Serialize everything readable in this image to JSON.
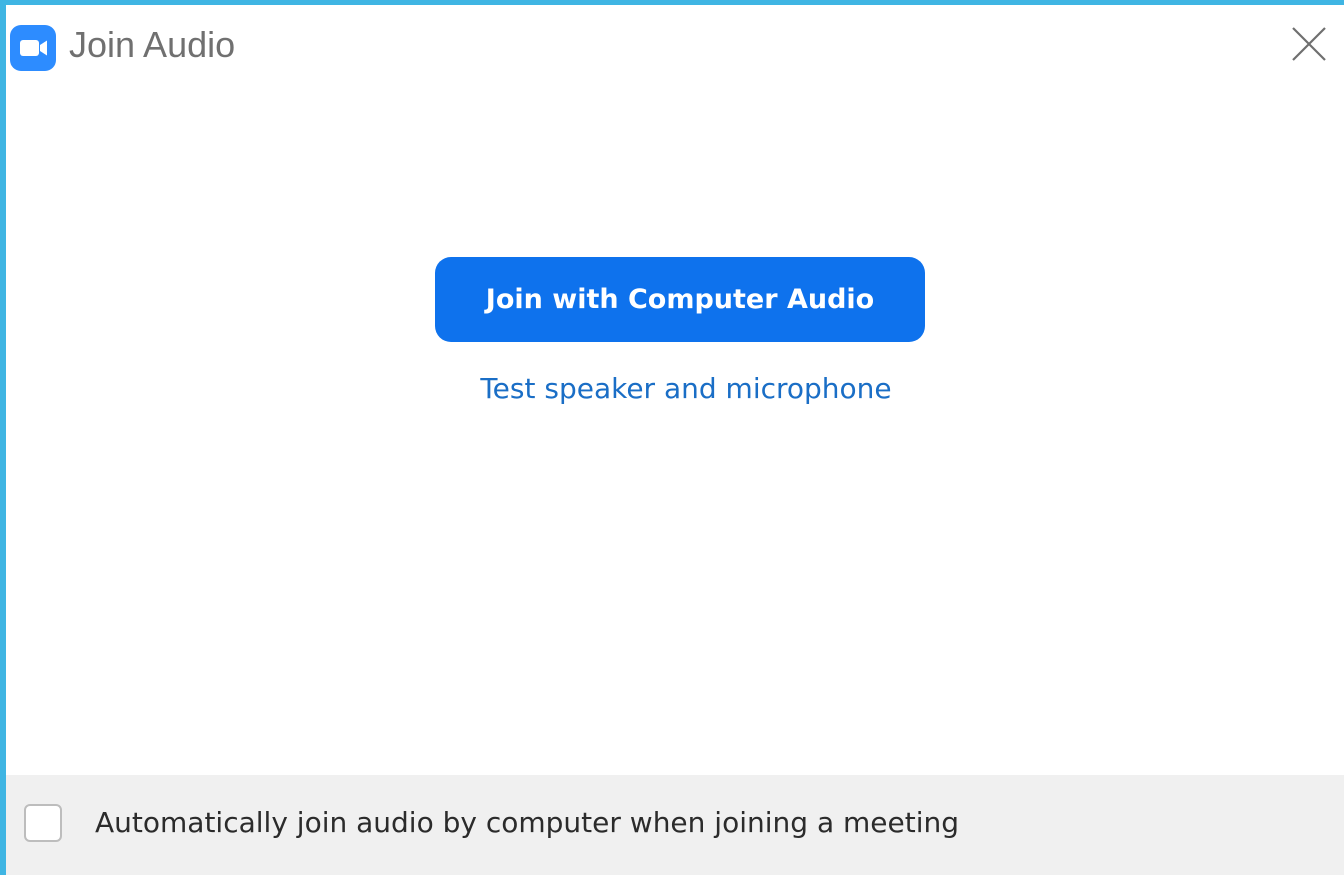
{
  "window": {
    "title": "Join Audio"
  },
  "main": {
    "join_button_label": "Join with Computer Audio",
    "test_link_label": "Test speaker and microphone"
  },
  "footer": {
    "auto_join_label": "Automatically join audio by computer when joining a meeting",
    "auto_join_checked": false
  },
  "colors": {
    "accent": "#0e72ed",
    "link": "#1a6ec6",
    "logo": "#2d8cff",
    "footer_background": "#f0f0f0"
  },
  "icons": {
    "app_logo": "zoom-camera-icon",
    "close": "close-icon"
  }
}
